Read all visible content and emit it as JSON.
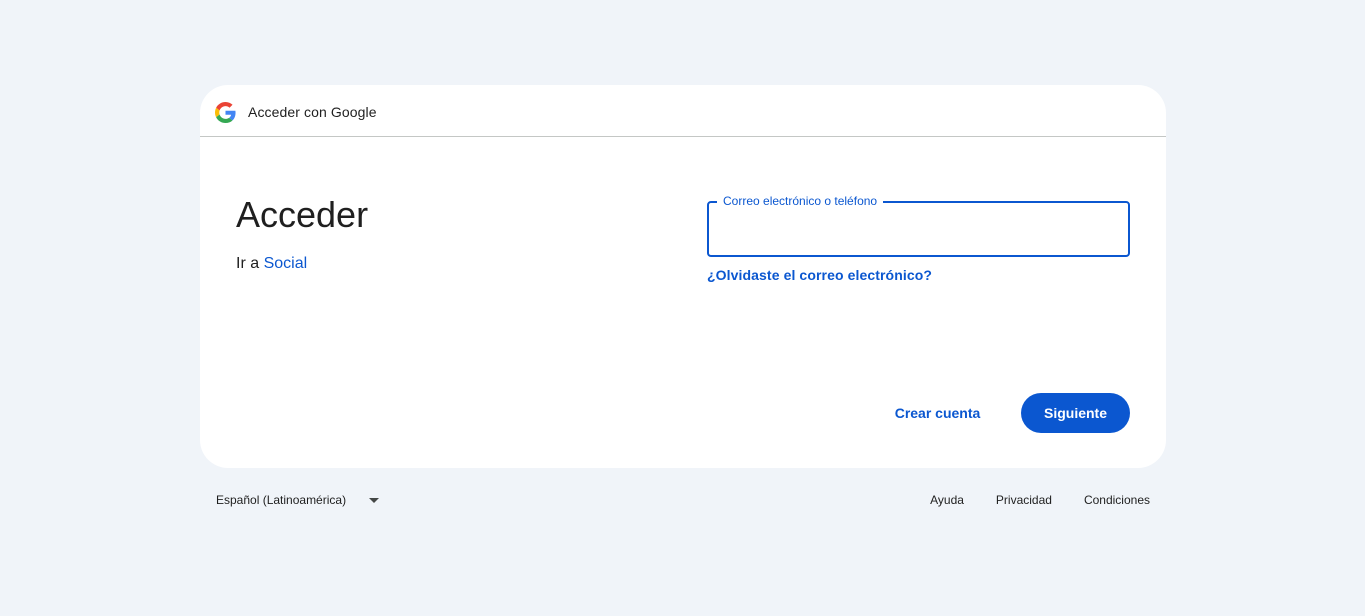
{
  "header": {
    "title": "Acceder con Google",
    "logo_icon": "google-g-icon"
  },
  "main": {
    "heading": "Acceder",
    "subtext_prefix": "Ir a ",
    "subtext_link": "Social"
  },
  "form": {
    "email_label": "Correo electrónico o teléfono",
    "email_value": "",
    "forgot_link": "¿Olvidaste el correo electrónico?"
  },
  "actions": {
    "create_account": "Crear cuenta",
    "next": "Siguiente"
  },
  "footer": {
    "language": "Español (Latinoamérica)",
    "links": [
      "Ayuda",
      "Privacidad",
      "Condiciones"
    ]
  },
  "colors": {
    "accent": "#0b57d0",
    "background": "#f0f4f9",
    "card": "#ffffff",
    "text": "#1f1f1f"
  }
}
